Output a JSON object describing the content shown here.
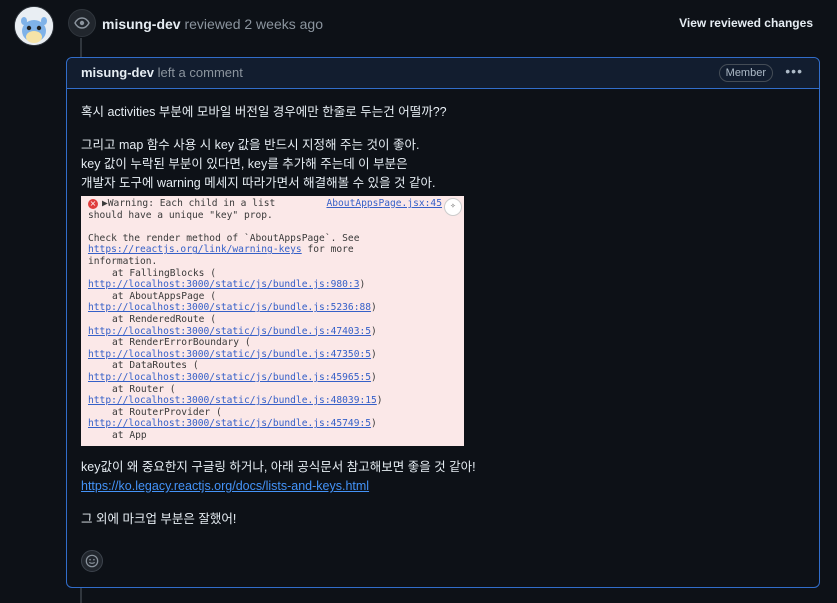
{
  "review": {
    "author": "misung-dev",
    "action": "reviewed 2 weeks ago",
    "view_changes_label": "View reviewed changes"
  },
  "comment": {
    "author": "misung-dev",
    "action": "left a comment",
    "badge": "Member",
    "menu_label": "•••",
    "paragraph1": "혹시 activities 부분에 모바일 버전일 경우에만 한줄로 두는건 어떨까??",
    "paragraph2_lines": [
      "그리고 map 함수 사용 시 key 값을 반드시 지정해 주는 것이 좋아.",
      "key 값이 누락된 부분이 있다면, key를 추가해 주는데 이 부분은",
      "개발자 도구에 warning 메세지 따라가면서 해결해볼 수 있을 것 같아."
    ],
    "paragraph3": "key값이 왜 중요한지 구글링 하거나, 아래 공식문서 참고해보면 좋을 것 같아!",
    "docs_link": "https://ko.legacy.reactjs.org/docs/lists-and-keys.html",
    "paragraph4": "그 외에 마크업 부분은 잘했어!"
  },
  "console": {
    "source_link": "AboutAppsPage.jsx:45",
    "warning_line1": "▶Warning: Each child in a list",
    "warning_line2": "should have a unique \"key\" prop.",
    "check_line": "Check the render method of `AboutAppsPage`. See",
    "warning_link": "https://reactjs.org/link/warning-keys",
    "for_more": " for more",
    "information": "information.",
    "stack": [
      {
        "at": "at FallingBlocks (",
        "link": "http://localhost:3000/static/js/bundle.js:980:3",
        "close": ")"
      },
      {
        "at": "at AboutAppsPage (",
        "link": "http://localhost:3000/static/js/bundle.js:5236:88",
        "close": ")"
      },
      {
        "at": "at RenderedRoute (",
        "link": "http://localhost:3000/static/js/bundle.js:47403:5",
        "close": ")"
      },
      {
        "at": "at RenderErrorBoundary (",
        "link": "http://localhost:3000/static/js/bundle.js:47350:5",
        "close": ")"
      },
      {
        "at": "at DataRoutes (",
        "link": "http://localhost:3000/static/js/bundle.js:45965:5",
        "close": ")"
      },
      {
        "at": "at Router (",
        "link": "http://localhost:3000/static/js/bundle.js:48039:15",
        "close": ")"
      },
      {
        "at": "at RouterProvider (",
        "link": "http://localhost:3000/static/js/bundle.js:45749:5",
        "close": ")"
      }
    ],
    "last_line": "at App"
  },
  "colors": {
    "background": "#0d1117",
    "accent_border": "#316dca",
    "link": "#4493f8",
    "console_bg": "#fbe8e8",
    "error_red": "#e03c3c"
  },
  "icons": {
    "review": "eye-icon",
    "reaction": "smiley-icon",
    "console_error": "error-x-icon",
    "console_hint": "lightbulb-icon"
  }
}
